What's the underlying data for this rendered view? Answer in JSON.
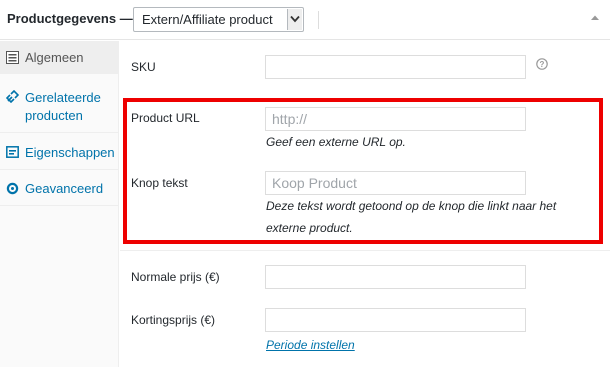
{
  "header": {
    "title": "Productgegevens —",
    "product_type": "Extern/Affiliate product"
  },
  "sidebar": {
    "tabs": [
      {
        "label": "Algemeen",
        "icon": "list-icon",
        "active": true
      },
      {
        "label": "Gerelateerde producten",
        "icon": "link-icon",
        "active": false
      },
      {
        "label": "Eigenschappen",
        "icon": "attributes-icon",
        "active": false
      },
      {
        "label": "Geavanceerd",
        "icon": "gear-icon",
        "active": false
      }
    ]
  },
  "fields": {
    "sku": {
      "label": "SKU",
      "value": ""
    },
    "product_url": {
      "label": "Product URL",
      "placeholder": "http://",
      "description": "Geef een externe URL op."
    },
    "button_text": {
      "label": "Knop tekst",
      "placeholder": "Koop Product",
      "description": "Deze tekst wordt getoond op de knop die linkt naar het externe product."
    },
    "regular_price": {
      "label": "Normale prijs (€)",
      "value": ""
    },
    "sale_price": {
      "label": "Kortingsprijs (€)",
      "value": "",
      "schedule_link": "Periode instellen"
    }
  },
  "colors": {
    "highlight": "#ee0000",
    "link": "#0073aa"
  }
}
